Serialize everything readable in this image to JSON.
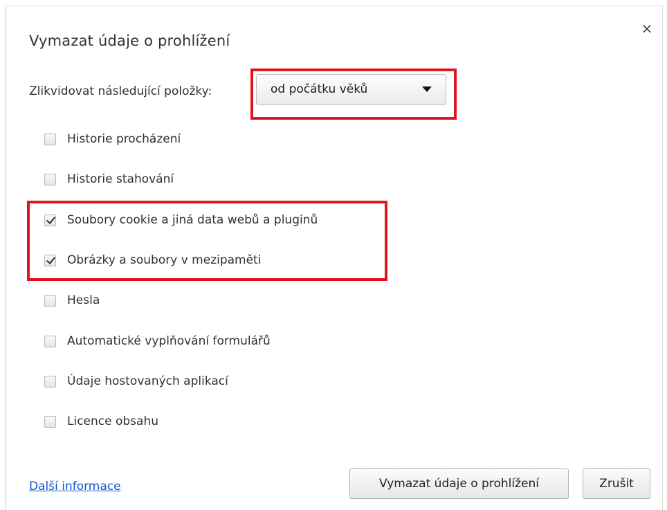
{
  "dialog": {
    "title": "Vymazat údaje o prohlížení",
    "close_glyph": "×"
  },
  "range": {
    "label": "Zlikvidovat následující položky:",
    "selected": "od počátku věků"
  },
  "options": [
    {
      "label": "Historie procházení",
      "checked": false
    },
    {
      "label": "Historie stahování",
      "checked": false
    },
    {
      "label": "Soubory cookie a jiná data webů a pluginů",
      "checked": true
    },
    {
      "label": "Obrázky a soubory v mezipaměti",
      "checked": true
    },
    {
      "label": "Hesla",
      "checked": false
    },
    {
      "label": "Automatické vyplňování formulářů",
      "checked": false
    },
    {
      "label": "Údaje hostovaných aplikací",
      "checked": false
    },
    {
      "label": "Licence obsahu",
      "checked": false
    }
  ],
  "footer": {
    "more_info": "Další informace",
    "clear_button": "Vymazat údaje o prohlížení",
    "cancel_button": "Zrušit"
  },
  "colors": {
    "highlight": "#e0141e",
    "link": "#1155cc"
  },
  "icons": {
    "close": "close-icon",
    "dropdown": "chevron-down-icon",
    "check": "checkmark-icon"
  }
}
